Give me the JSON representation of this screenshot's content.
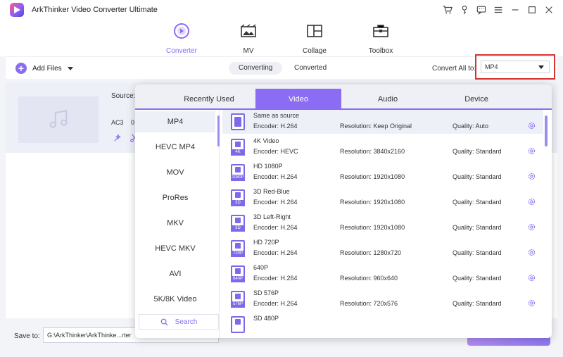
{
  "app": {
    "title": "ArkThinker Video Converter Ultimate"
  },
  "nav": [
    {
      "label": "Converter",
      "icon": "converter-icon",
      "active": true
    },
    {
      "label": "MV",
      "icon": "mv-icon",
      "active": false
    },
    {
      "label": "Collage",
      "icon": "collage-icon",
      "active": false
    },
    {
      "label": "Toolbox",
      "icon": "toolbox-icon",
      "active": false
    }
  ],
  "toolbar": {
    "add_files": "Add Files",
    "tab_converting": "Converting",
    "tab_converted": "Converted",
    "convert_all_label": "Convert All to:",
    "convert_all_value": "MP4"
  },
  "file": {
    "source_label": "Source:",
    "audio": "AC3",
    "partial": "0"
  },
  "popup": {
    "tabs": [
      "Recently Used",
      "Video",
      "Audio",
      "Device"
    ],
    "active_tab": "Video",
    "formats": [
      "MP4",
      "HEVC MP4",
      "MOV",
      "ProRes",
      "MKV",
      "HEVC MKV",
      "AVI",
      "5K/8K Video"
    ],
    "active_format": "MP4",
    "search_label": "Search",
    "presets": [
      {
        "name": "Same as source",
        "encoder": "Encoder: H.264",
        "resolution": "Resolution: Keep Original",
        "quality": "Quality: Auto",
        "tag": ""
      },
      {
        "name": "4K Video",
        "encoder": "Encoder: HEVC",
        "resolution": "Resolution: 3840x2160",
        "quality": "Quality: Standard",
        "tag": "4K"
      },
      {
        "name": "HD 1080P",
        "encoder": "Encoder: H.264",
        "resolution": "Resolution: 1920x1080",
        "quality": "Quality: Standard",
        "tag": "1080P"
      },
      {
        "name": "3D Red-Blue",
        "encoder": "Encoder: H.264",
        "resolution": "Resolution: 1920x1080",
        "quality": "Quality: Standard",
        "tag": "3D"
      },
      {
        "name": "3D Left-Right",
        "encoder": "Encoder: H.264",
        "resolution": "Resolution: 1920x1080",
        "quality": "Quality: Standard",
        "tag": "3D"
      },
      {
        "name": "HD 720P",
        "encoder": "Encoder: H.264",
        "resolution": "Resolution: 1280x720",
        "quality": "Quality: Standard",
        "tag": "720P"
      },
      {
        "name": "640P",
        "encoder": "Encoder: H.264",
        "resolution": "Resolution: 960x640",
        "quality": "Quality: Standard",
        "tag": "640P"
      },
      {
        "name": "SD 576P",
        "encoder": "Encoder: H.264",
        "resolution": "Resolution: 720x576",
        "quality": "Quality: Standard",
        "tag": "576P"
      },
      {
        "name": "SD 480P",
        "encoder": "",
        "resolution": "",
        "quality": "",
        "tag": ""
      }
    ]
  },
  "bottom": {
    "save_label": "Save to:",
    "save_path": "G:\\ArkThinker\\ArkThinke...rter"
  },
  "colors": {
    "accent": "#8a6df2",
    "highlight_border": "#d5312f",
    "active_row": "#eef0f8"
  }
}
